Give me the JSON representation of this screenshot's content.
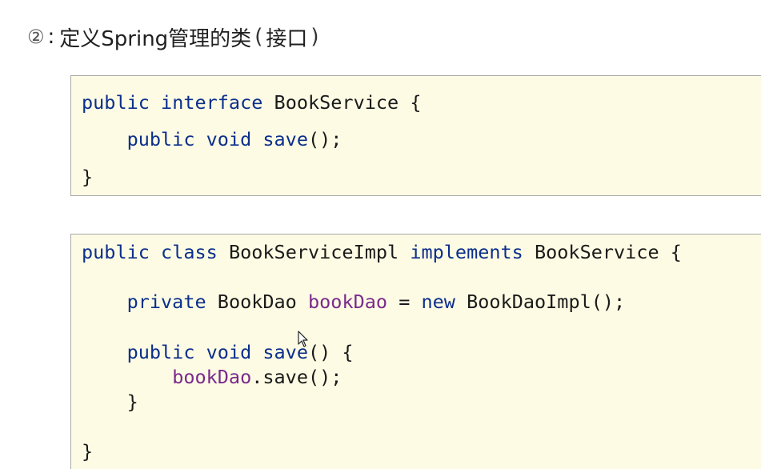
{
  "heading": {
    "number": "②",
    "colon": ":",
    "text": "定义Spring管理的类",
    "paren_open": "(",
    "paren_text": "接口",
    "paren_close": ")"
  },
  "code_block_1": {
    "l1": {
      "t1": "public",
      "t2": "interface",
      "t3": "BookService",
      "t4": "{"
    },
    "l2": {
      "t1": "public",
      "t2": "void",
      "t3": "save",
      "t4": "();"
    },
    "l3": {
      "t1": "}"
    }
  },
  "code_block_2": {
    "l1": {
      "t1": "public",
      "t2": "class",
      "t3": "BookServiceImpl",
      "t4": "implements",
      "t5": "BookService",
      "t6": "{"
    },
    "l2": {
      "t1": "private",
      "t2": "BookDao",
      "t3": "bookDao",
      "t4": "=",
      "t5": "new",
      "t6": "BookDaoImpl();"
    },
    "l3": {
      "t1": "public",
      "t2": "void",
      "t3": "save",
      "t4": "() {"
    },
    "l4": {
      "t1": "bookDao",
      "t2": ".save();"
    },
    "l5": {
      "t1": "}"
    },
    "l6": {
      "t1": "}"
    }
  }
}
